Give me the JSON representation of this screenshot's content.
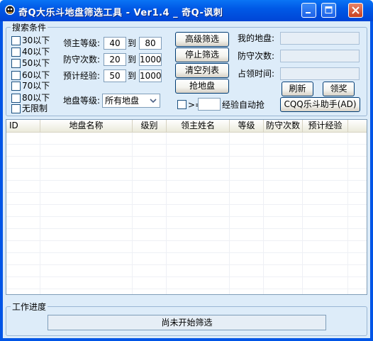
{
  "window": {
    "title": "奇Q大乐斗地盘筛选工具 - Ver1.4 _ 奇Q-讽刺"
  },
  "search": {
    "legend": "搜索条件",
    "level_filters": [
      {
        "label": "30以下",
        "checked": false
      },
      {
        "label": "40以下",
        "checked": false
      },
      {
        "label": "50以下",
        "checked": false
      },
      {
        "label": "60以下",
        "checked": false
      },
      {
        "label": "70以下",
        "checked": false
      },
      {
        "label": "80以下",
        "checked": false
      },
      {
        "label": "无限制",
        "checked": false
      }
    ],
    "lord_level": {
      "label": "领主等级:",
      "from": "40",
      "to_label": "到",
      "to": "80"
    },
    "defense_count": {
      "label": "防守次数:",
      "from": "20",
      "to_label": "到",
      "to": "1000"
    },
    "expected_exp": {
      "label": "预计经验:",
      "from": "50",
      "to_label": "到",
      "to": "1000"
    },
    "land_level": {
      "label": "地盘等级:",
      "selected": "所有地盘"
    },
    "buttons": {
      "advanced_filter": "高级筛选",
      "stop_filter": "停止筛选",
      "clear_list": "清空列表",
      "grab_land": "抢地盘"
    },
    "auto_grab": {
      "checkbox_label": ">=",
      "value": "",
      "suffix": "经验自动抢",
      "checked": false
    },
    "my_land": {
      "label": "我的地盘:",
      "value": ""
    },
    "my_defense": {
      "label": "防守次数:",
      "value": ""
    },
    "occupy_time": {
      "label": "占领时间:",
      "value": ""
    },
    "refresh_button": "刷新",
    "claim_button": "领奖",
    "helper_button": "CQQ乐斗助手(AD)"
  },
  "list": {
    "columns": [
      "ID",
      "地盘名称",
      "级别",
      "领主姓名",
      "等级",
      "防守次数",
      "预计经验"
    ],
    "rows": []
  },
  "progress": {
    "legend": "工作进度",
    "status": "尚未开始筛选"
  },
  "colors": {
    "titlebar": "#0055e6",
    "client_bg": "#ddecf9",
    "group_border": "#9ab6d4"
  }
}
